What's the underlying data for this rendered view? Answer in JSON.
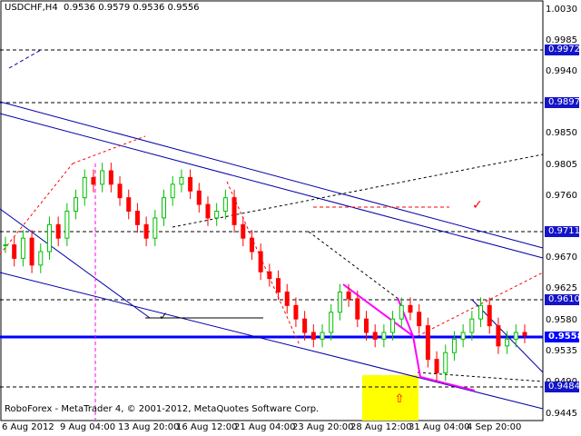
{
  "header": {
    "symbol_tf": "USDCHF,H4",
    "ohlc": "0.9536 0.9579 0.9536 0.9556"
  },
  "footer": {
    "copyright": "RoboForex - MetaTrader 4, © 2001-2012, MetaQuotes Software Corp."
  },
  "colors": {
    "background": "#ffffff",
    "candle_up": "#00c000",
    "candle_down": "#ff0000",
    "trendline": "#0000aa",
    "projection": "#ff0000",
    "magenta": "#ff00ff",
    "level_tag": "#1414c8",
    "current_line": "#0000ff",
    "highlight": "#ffff00"
  },
  "price_axis": {
    "ticks": [
      "1.0030",
      "0.9985",
      "0.9940",
      "0.9850",
      "0.9805",
      "0.9760",
      "0.9670",
      "0.9625",
      "0.9580",
      "0.9535",
      "0.9490",
      "0.9445"
    ]
  },
  "level_tags": [
    {
      "label": "0.9972"
    },
    {
      "label": "0.9897"
    },
    {
      "label": "0.9711"
    },
    {
      "label": "0.9610"
    },
    {
      "label": "0.9558"
    },
    {
      "label": "0.9484"
    }
  ],
  "time_axis": {
    "ticks": [
      "6 Aug 2012",
      "9 Aug 04:00",
      "13 Aug 20:00",
      "16 Aug 12:00",
      "21 Aug 04:00",
      "23 Aug 20:00",
      "28 Aug 12:00",
      "31 Aug 04:00",
      "4 Sep 20:00"
    ]
  },
  "chart_data": {
    "type": "candlestick",
    "symbol": "USDCHF",
    "timeframe": "H4",
    "ylim": [
      0.944,
      1.004
    ],
    "current_price": 0.9558,
    "horizontal_levels": [
      0.9972,
      0.9897,
      0.9711,
      0.961,
      0.9558,
      0.9484
    ],
    "close_path": [
      0.969,
      0.967,
      0.97,
      0.966,
      0.968,
      0.972,
      0.97,
      0.974,
      0.976,
      0.979,
      0.978,
      0.98,
      0.978,
      0.976,
      0.974,
      0.972,
      0.97,
      0.973,
      0.976,
      0.978,
      0.979,
      0.977,
      0.975,
      0.973,
      0.974,
      0.976,
      0.972,
      0.97,
      0.968,
      0.965,
      0.964,
      0.962,
      0.96,
      0.958,
      0.956,
      0.955,
      0.956,
      0.959,
      0.962,
      0.961,
      0.958,
      0.956,
      0.955,
      0.956,
      0.958,
      0.96,
      0.959,
      0.957,
      0.952,
      0.95,
      0.953,
      0.955,
      0.956,
      0.958,
      0.96,
      0.957,
      0.954,
      0.955,
      0.956,
      0.9556
    ]
  }
}
